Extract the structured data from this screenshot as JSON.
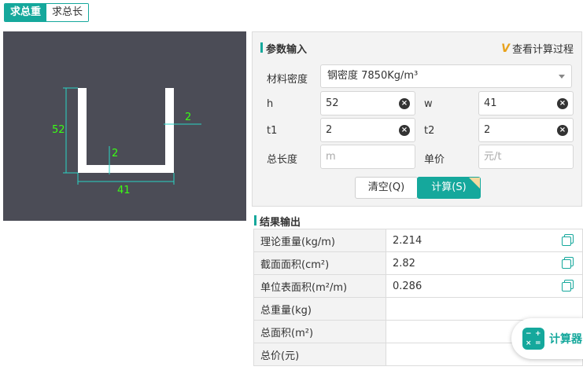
{
  "tabs": [
    {
      "label": "求总重",
      "active": true
    },
    {
      "label": "求总长",
      "active": false
    }
  ],
  "drawing": {
    "dim_h": "52",
    "dim_w": "41",
    "dim_t1": "2",
    "dim_t2": "2",
    "line_color": "#2ad3c4",
    "text_color": "#39ff14"
  },
  "params": {
    "title": "参数输入",
    "view_process": "查看计算过程",
    "material_label": "材料密度",
    "material_value": "钢密度 7850Kg/m³",
    "h_label": "h",
    "h_value": "52",
    "w_label": "w",
    "w_value": "41",
    "t1_label": "t1",
    "t1_value": "2",
    "t2_label": "t2",
    "t2_value": "2",
    "length_label": "总长度",
    "length_placeholder": "m",
    "price_label": "单价",
    "price_placeholder": "元/t",
    "clear_button": "清空(Q)",
    "calc_button": "计算(S)"
  },
  "results": {
    "title": "结果输出",
    "rows": [
      {
        "label": "理论重量(kg/m)",
        "value": "2.214",
        "copy": true
      },
      {
        "label": "截面面积(cm²)",
        "value": "2.82",
        "copy": true
      },
      {
        "label": "单位表面积(m²/m)",
        "value": "0.286",
        "copy": true
      },
      {
        "label": "总重量(kg)",
        "value": "",
        "copy": false
      },
      {
        "label": "总面积(m²)",
        "value": "",
        "copy": false
      },
      {
        "label": "总价(元)",
        "value": "",
        "copy": false
      }
    ]
  },
  "fab": {
    "label": "计算器"
  },
  "colors": {
    "accent": "#15a89c",
    "panel_bg": "#f3f3f3",
    "drawing_bg": "#4b4c56"
  }
}
